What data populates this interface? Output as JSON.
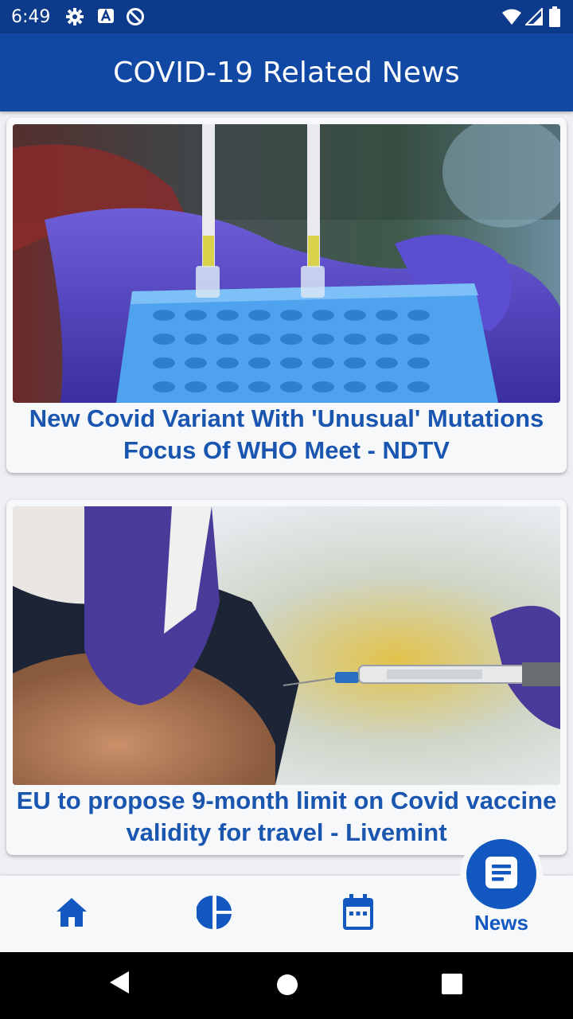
{
  "status_bar": {
    "time": "6:49",
    "icons": [
      "gear-icon",
      "a-badge-icon",
      "do-not-disturb-icon",
      "wifi-icon",
      "cell-signal-icon",
      "battery-icon"
    ]
  },
  "app_bar": {
    "title": "COVID-19 Related News"
  },
  "news": [
    {
      "headline": "New Covid Variant With 'Unusual' Mutations Focus Of WHO Meet - NDTV",
      "image": "lab-test-tubes-photo"
    },
    {
      "headline": "EU to propose 9-month limit on Covid vaccine validity for travel - Livemint",
      "image": "vaccine-injection-photo"
    }
  ],
  "bottom_nav": {
    "items": [
      {
        "icon": "home-icon"
      },
      {
        "icon": "pie-chart-icon"
      },
      {
        "icon": "calendar-icon"
      },
      {
        "icon": "news-icon",
        "label": "News",
        "selected": true
      }
    ]
  },
  "colors": {
    "primary": "#1048a4",
    "accent": "#1258c0",
    "headline": "#1a56b0",
    "statusbar": "#0d3a8a"
  }
}
